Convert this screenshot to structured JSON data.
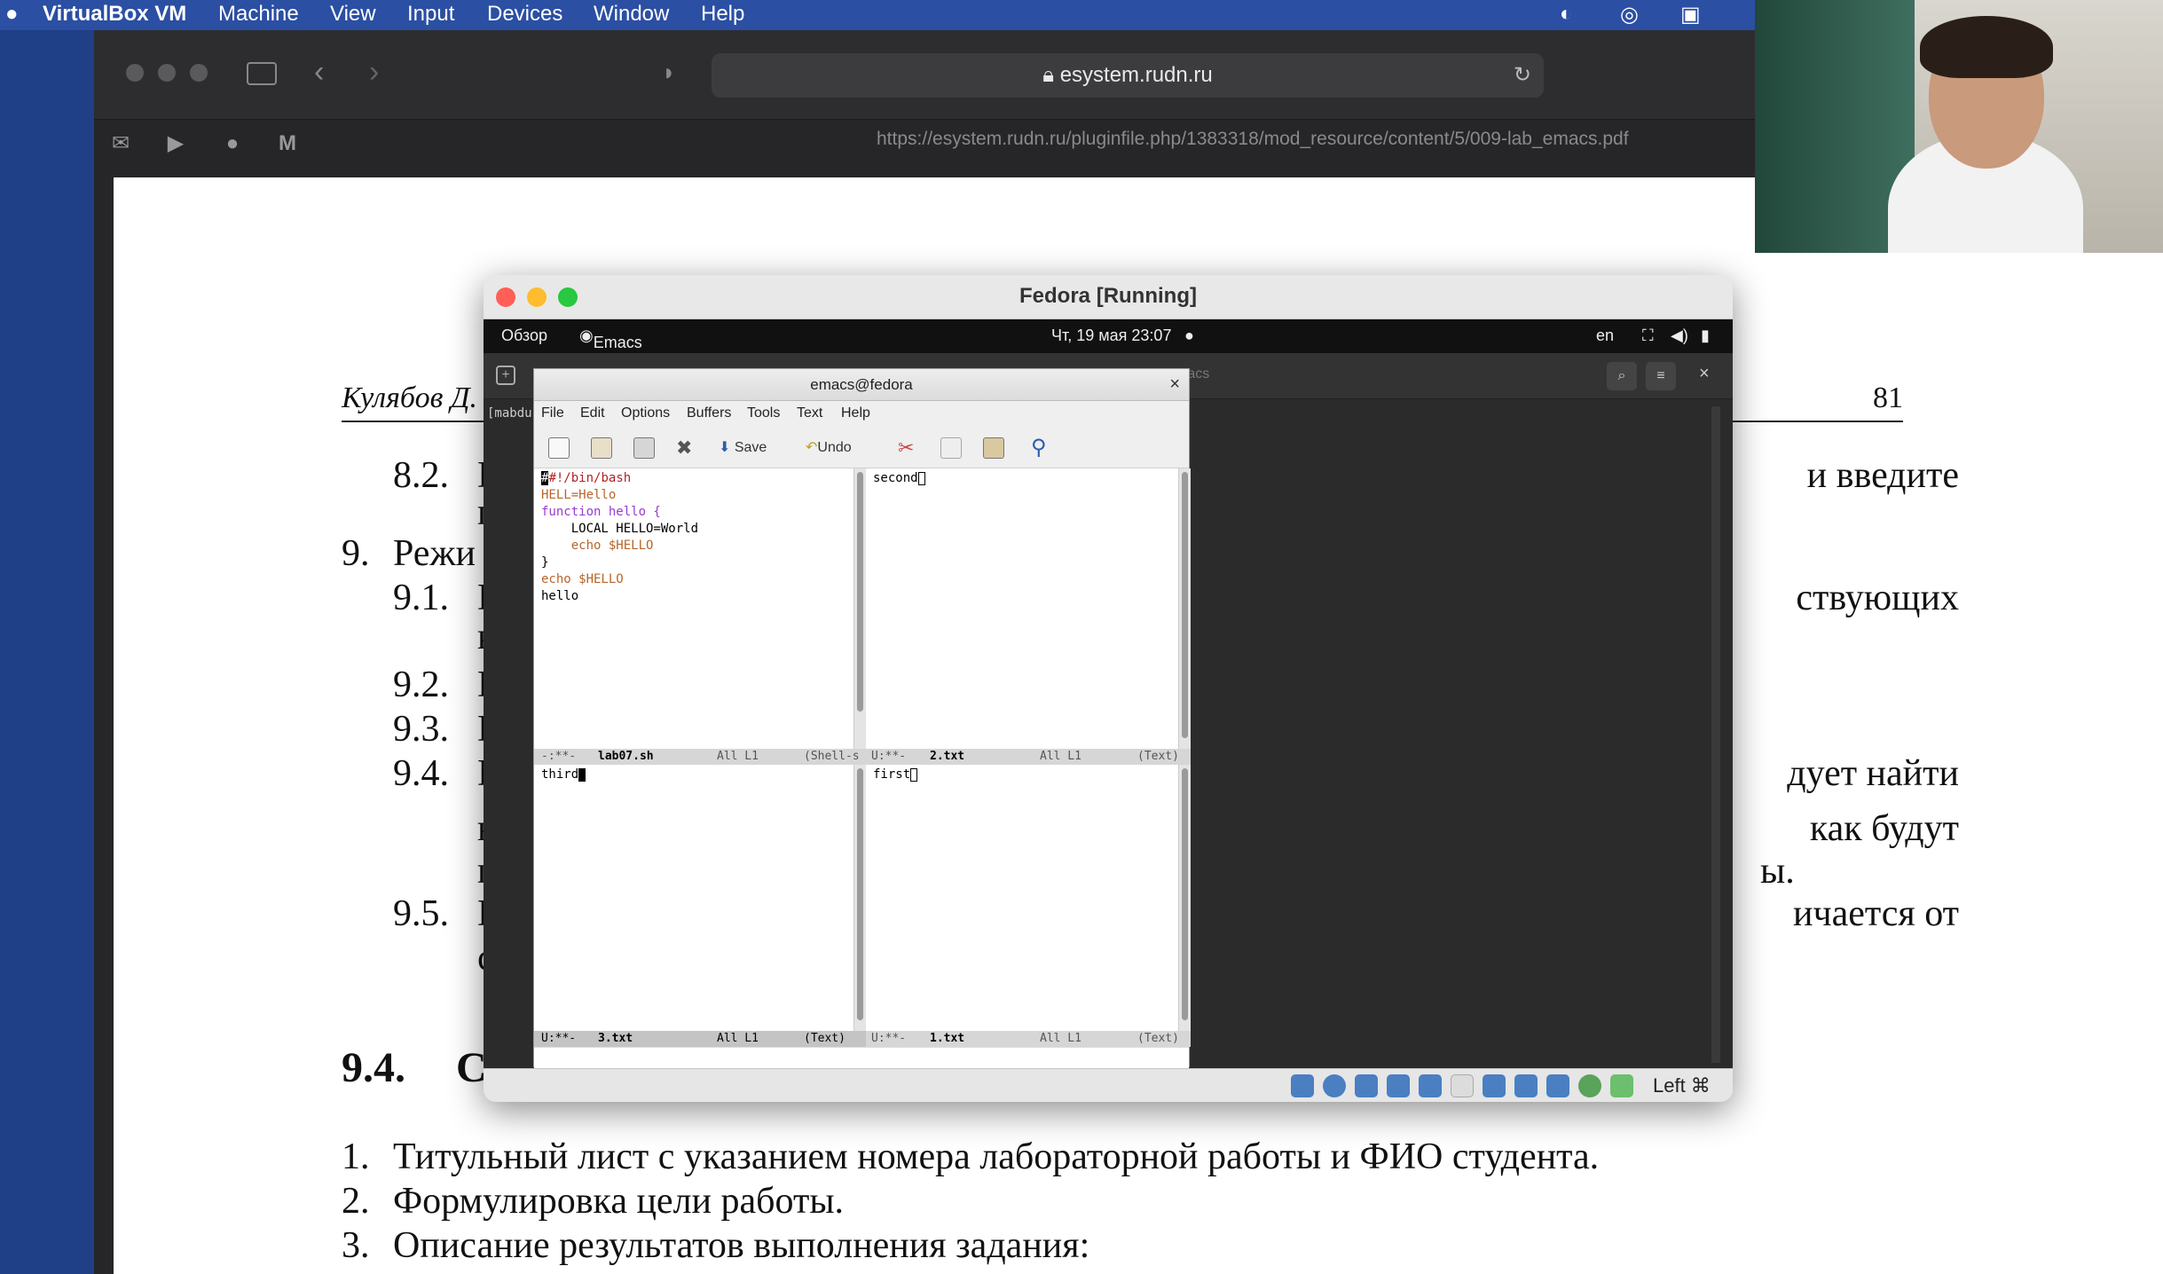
{
  "menubar": {
    "app": "VirtualBox VM",
    "items": [
      "Machine",
      "View",
      "Input",
      "Devices",
      "Window",
      "Help"
    ]
  },
  "browser": {
    "address": "esystem.rudn.ru",
    "link_url": "https://esystem.rudn.ru/pluginfile.php/1383318/mod_resource/content/5/009-lab_emacs.pdf",
    "favorites": [
      "mail-icon",
      "youtube-icon",
      "apple-icon",
      "gmail-icon"
    ]
  },
  "document": {
    "header_author": "Кулябов Д.",
    "page_number": "81",
    "visible_items": [
      {
        "num": "8.2.",
        "left": "Н",
        "right": "и введите"
      },
      {
        "num": "",
        "left": "п",
        "right": ""
      },
      {
        "num": "9.",
        "left": "Режи",
        "right": ""
      },
      {
        "num": "9.1.",
        "left": "Н",
        "right": "ствующих"
      },
      {
        "num": "",
        "left": "к",
        "right": ""
      },
      {
        "num": "9.2.",
        "left": "Н",
        "right": ""
      },
      {
        "num": "9.3.",
        "left": "Н",
        "right": ""
      },
      {
        "num": "9.4.",
        "left": "Н",
        "right": "дует найти"
      },
      {
        "num": "",
        "left": "н",
        "right": "как будут"
      },
      {
        "num": "",
        "left": "п",
        "right": "ы."
      },
      {
        "num": "9.5.",
        "left": "Н",
        "right": "ичается от"
      },
      {
        "num": "",
        "left": "с",
        "right": ""
      }
    ],
    "section_num": "9.4.",
    "section_title_start": "С",
    "list": [
      {
        "n": "1.",
        "text": "Титульный лист с указанием номера лабораторной работы и ФИО студента."
      },
      {
        "n": "2.",
        "text": "Формулировка цели работы."
      },
      {
        "n": "3.",
        "text": "Описание результатов выполнения задания:"
      }
    ]
  },
  "vm": {
    "title": "Fedora [Running]",
    "gnome": {
      "overview": "Обзор",
      "app": "Emacs",
      "clock": "Чт, 19 мая  23:07",
      "lang": "en"
    },
    "terminal": {
      "title_fragment": "macs",
      "prompt": "[mabdu"
    },
    "status_right": "Left ⌘"
  },
  "emacs": {
    "title": "emacs@fedora",
    "menu": [
      "File",
      "Edit",
      "Options",
      "Buffers",
      "Tools",
      "Text",
      "Help"
    ],
    "toolbar": {
      "save": "Save",
      "undo": "Undo"
    },
    "windows": {
      "top_left": {
        "lines": [
          "#!/bin/bash",
          "HELL=Hello",
          "function hello {",
          "    LOCAL HELLO=World",
          "    echo $HELLO",
          "}",
          "echo $HELLO",
          "hello"
        ],
        "modeline": {
          "status": "-:**-",
          "name": "lab07.sh",
          "pos": "All L1",
          "mode": "(Shell-s"
        }
      },
      "top_right": {
        "lines": [
          "second"
        ],
        "modeline": {
          "status": "U:**-",
          "name": "2.txt",
          "pos": "All L1",
          "mode": "(Text)"
        }
      },
      "bottom_left": {
        "lines": [
          "third"
        ],
        "modeline": {
          "status": "U:**-",
          "name": "3.txt",
          "pos": "All L1",
          "mode": "(Text)"
        }
      },
      "bottom_right": {
        "lines": [
          "first"
        ],
        "modeline": {
          "status": "U:**-",
          "name": "1.txt",
          "pos": "All L1",
          "mode": "(Text)"
        }
      }
    }
  }
}
